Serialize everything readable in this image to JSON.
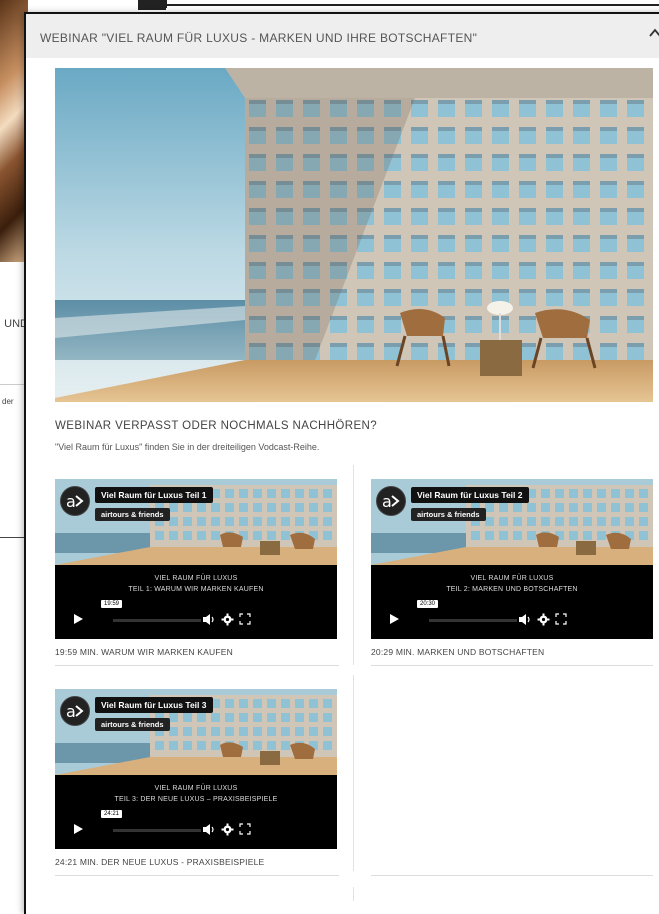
{
  "background": {
    "text_und": "UND",
    "text_der": "der"
  },
  "modal": {
    "title": "WEBINAR \"VIEL RAUM FÜR LUXUS - MARKEN UND IHRE BOTSCHAFTEN\"",
    "collapse_icon": "chevron-up-icon"
  },
  "section": {
    "heading": "WEBINAR VERPASST ODER NOCHMALS NACHHÖREN?",
    "subtitle": "\"Viel Raum für Luxus\" finden Sie in der dreiteiligen Vodcast-Reihe."
  },
  "videos": [
    {
      "title": "Viel Raum für Luxus Teil 1",
      "author": "airtours & friends",
      "caption1": "VIEL RAUM FÜR LUXUS",
      "caption2": "TEIL 1: WARUM WIR MARKEN KAUFEN",
      "time": "19:59",
      "label": "19:59 MIN. WARUM WIR MARKEN KAUFEN"
    },
    {
      "title": "Viel Raum für Luxus Teil 2",
      "author": "airtours & friends",
      "caption1": "VIEL RAUM FÜR LUXUS",
      "caption2": "TEIL 2: MARKEN UND BOTSCHAFTEN",
      "time": "20:30",
      "label": "20:29 MIN. MARKEN UND BOTSCHAFTEN"
    },
    {
      "title": "Viel Raum für Luxus Teil 3",
      "author": "airtours & friends",
      "caption1": "VIEL RAUM FÜR LUXUS",
      "caption2": "TEIL 3: DER NEUE LUXUS – PRAXISBEISPIELE",
      "time": "24:21",
      "label": "24:21 MIN. DER NEUE LUXUS - PRAXISBEISPIELE"
    }
  ],
  "colors": {
    "header_bg": "#eeeeee",
    "player_bg": "#000000"
  }
}
